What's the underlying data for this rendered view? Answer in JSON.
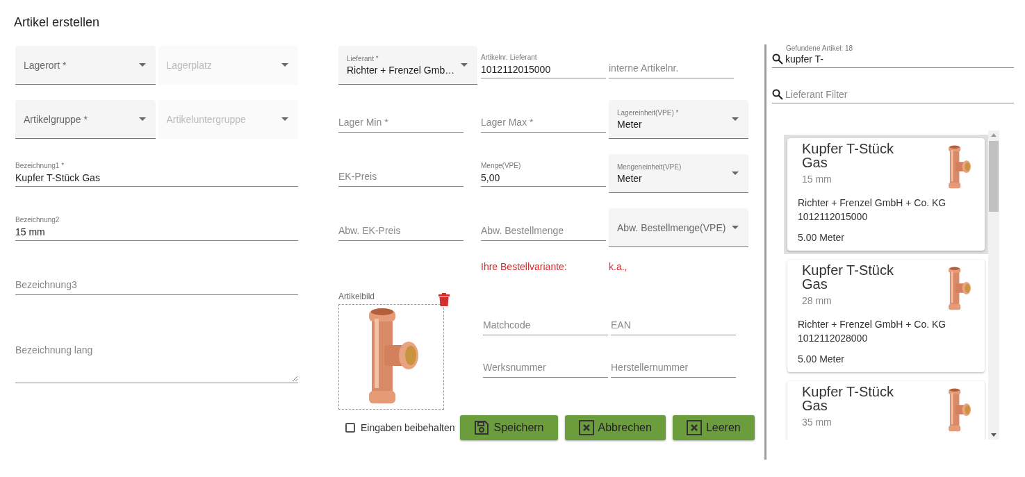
{
  "title": "Artikel erstellen",
  "left_rows": [
    [
      {
        "kind": "select",
        "placeholder": "Lagerort *",
        "disabled": false
      },
      {
        "kind": "select",
        "placeholder": "Lagerplatz",
        "disabled": true
      }
    ],
    [
      {
        "kind": "select",
        "placeholder": "Artikelgruppe *",
        "disabled": false
      },
      {
        "kind": "select",
        "placeholder": "Artikeluntergruppe",
        "disabled": true
      }
    ],
    [
      {
        "kind": "text",
        "label": "Bezeichnung1 *",
        "value": "Kupfer T-Stück Gas"
      }
    ],
    [
      {
        "kind": "text",
        "label": "Bezeichnung2",
        "value": "15 mm"
      }
    ],
    [
      {
        "kind": "text",
        "placeholder": "Bezeichnung3"
      }
    ],
    [
      {
        "kind": "textarea",
        "placeholder": "Bezeichnung lang"
      }
    ]
  ],
  "middle_rows": [
    [
      {
        "kind": "select",
        "label": "Lieferant *",
        "value": "Richter + Frenzel Gmb…",
        "disabled": false
      },
      {
        "kind": "text",
        "label": "Artikelnr. Lieferant",
        "value": "1012112015000"
      },
      {
        "kind": "text",
        "placeholder": "interne Artikelnr."
      }
    ],
    [
      {
        "kind": "text",
        "placeholder": "Lager Min *"
      },
      {
        "kind": "text",
        "placeholder": "Lager Max *"
      },
      {
        "kind": "select",
        "label": "Lagereinheit(VPE) *",
        "value": "Meter",
        "disabled": false
      }
    ],
    [
      {
        "kind": "text",
        "placeholder": "EK-Preis"
      },
      {
        "kind": "text",
        "label": "Menge(VPE)",
        "value": "5,00"
      },
      {
        "kind": "select",
        "label": "Mengeneinheit(VPE)",
        "value": "Meter",
        "disabled": false
      }
    ],
    [
      {
        "kind": "text",
        "placeholder": "Abw. EK-Preis"
      },
      {
        "kind": "text",
        "placeholder": "Abw. Bestellmenge"
      },
      {
        "kind": "select",
        "placeholder": "Abw. Bestellmenge(VPE)",
        "disabled": false
      }
    ]
  ],
  "order_variant": {
    "label": "Ihre Bestellvariante:",
    "value": "k.a.,"
  },
  "image": {
    "label": "Artikelbild",
    "kind": "picture"
  },
  "extra_fields": [
    {
      "kind": "text",
      "placeholder": "Matchcode"
    },
    {
      "kind": "text",
      "placeholder": "EAN"
    },
    {
      "kind": "text",
      "placeholder": "Werksnummer"
    },
    {
      "kind": "text",
      "placeholder": "Herstellernummer"
    }
  ],
  "keep_inputs": {
    "label": "Eingaben beibehalten",
    "checked": false
  },
  "buttons": [
    {
      "label": "Speichern",
      "kind": "save"
    },
    {
      "label": "Abbrechen",
      "kind": "cancel"
    },
    {
      "label": "Leeren",
      "kind": "clear"
    }
  ],
  "search": {
    "count_label": "Gefundene Artikel: 18",
    "value": "kupfer T-"
  },
  "supplier_filter": {
    "placeholder": "Lieferant Filter"
  },
  "results": [
    {
      "title": "Kupfer T-Stück Gas",
      "size": "15 mm",
      "supplier": "Richter + Frenzel GmbH + Co. KG",
      "article_no": "1012112015000",
      "quantity": "5.00 Meter",
      "selected": true
    },
    {
      "title": "Kupfer T-Stück Gas",
      "size": "28 mm",
      "supplier": "Richter + Frenzel GmbH + Co. KG",
      "article_no": "1012112028000",
      "quantity": "5.00 Meter",
      "selected": false
    },
    {
      "title": "Kupfer T-Stück Gas",
      "size": "35 mm",
      "selected": false
    }
  ]
}
